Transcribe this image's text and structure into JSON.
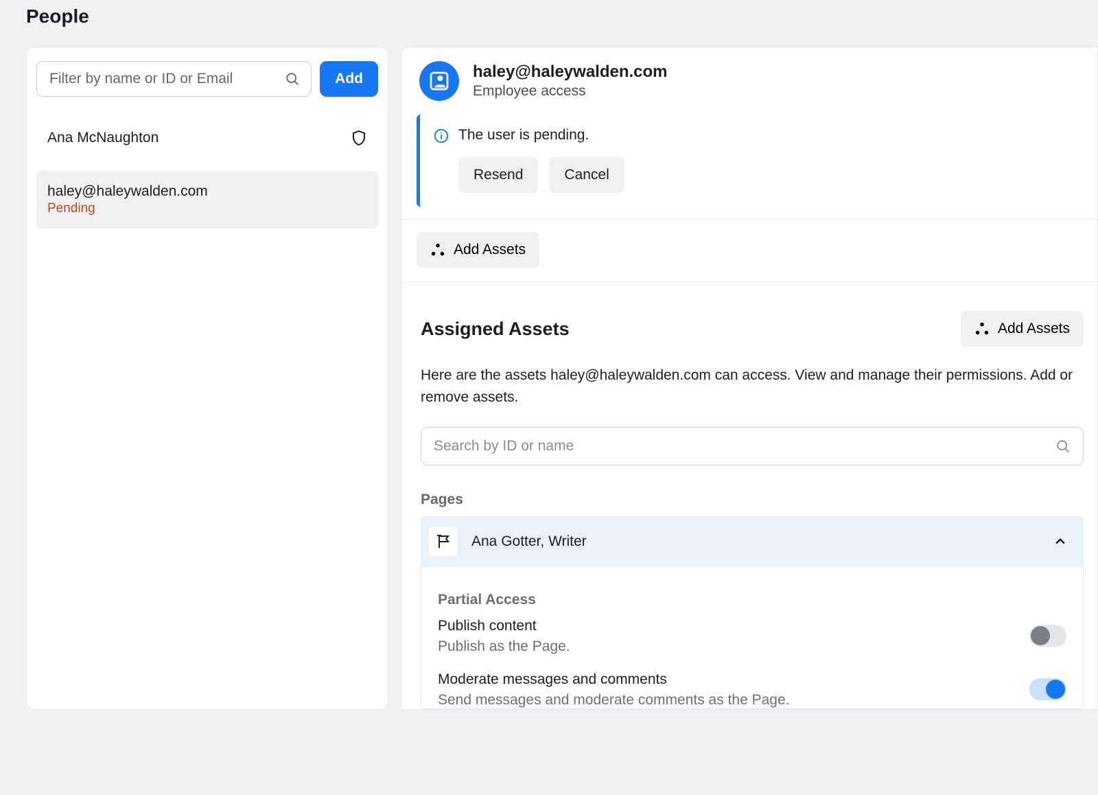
{
  "page": {
    "title": "People"
  },
  "filter": {
    "placeholder": "Filter by name or ID or Email",
    "add_label": "Add"
  },
  "people": [
    {
      "name": "Ana McNaughton",
      "status": ""
    },
    {
      "name": "haley@haleywalden.com",
      "status": "Pending"
    }
  ],
  "detail": {
    "user_name": "haley@haleywalden.com",
    "user_role": "Employee access",
    "alert_text": "The user is pending.",
    "resend_label": "Resend",
    "cancel_label": "Cancel",
    "add_assets_label": "Add Assets"
  },
  "assigned": {
    "title": "Assigned Assets",
    "add_assets_label": "Add Assets",
    "description": "Here are the assets haley@haleywalden.com can access. View and manage their permissions. Add or remove assets.",
    "search_placeholder": "Search by ID or name",
    "pages_label": "Pages",
    "page_name": "Ana Gotter, Writer",
    "perm_group": "Partial Access",
    "perms": [
      {
        "title": "Publish content",
        "desc": "Publish as the Page.",
        "on": false
      },
      {
        "title": "Moderate messages and comments",
        "desc": "Send messages and moderate comments as the Page.",
        "on": true
      }
    ]
  }
}
